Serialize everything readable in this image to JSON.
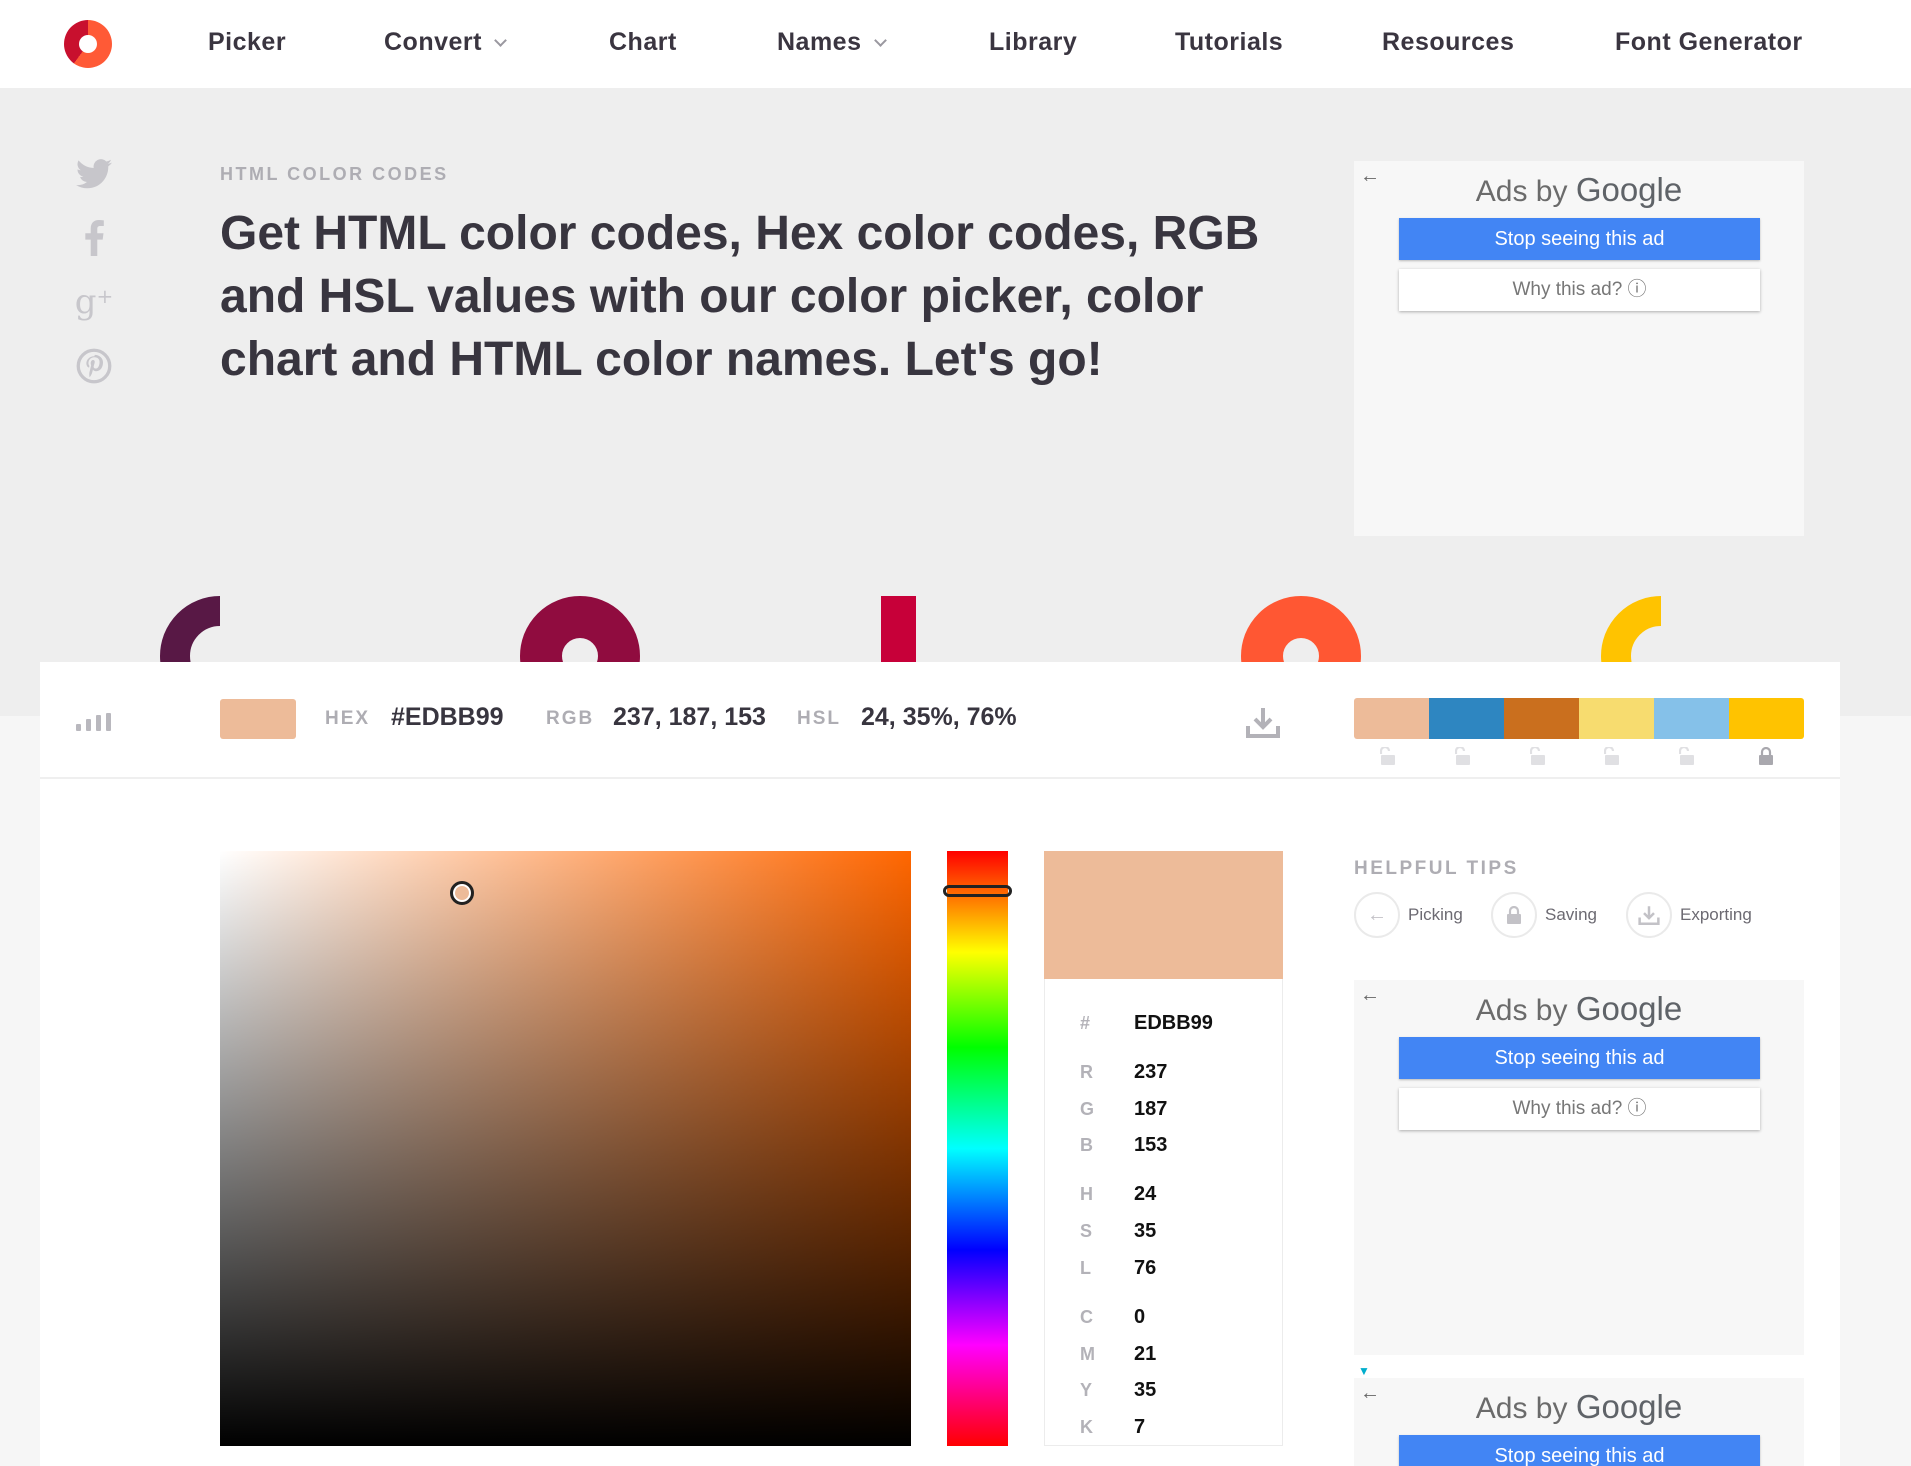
{
  "nav": {
    "items": [
      {
        "label": "Picker",
        "has_dropdown": false
      },
      {
        "label": "Convert",
        "has_dropdown": true
      },
      {
        "label": "Chart",
        "has_dropdown": false
      },
      {
        "label": "Names",
        "has_dropdown": true
      },
      {
        "label": "Library",
        "has_dropdown": false
      },
      {
        "label": "Tutorials",
        "has_dropdown": false
      },
      {
        "label": "Resources",
        "has_dropdown": false
      },
      {
        "label": "Font Generator",
        "has_dropdown": false
      }
    ]
  },
  "social": [
    "twitter-icon",
    "facebook-icon",
    "google-plus-icon",
    "pinterest-icon"
  ],
  "hero": {
    "eyebrow": "HTML COLOR CODES",
    "headline": "Get HTML color codes, Hex color codes, RGB and HSL values with our color picker, color chart and HTML color names. Let's go!"
  },
  "ads": {
    "title_prefix": "Ads by ",
    "title_brand": "Google",
    "stop_label": "Stop seeing this ad",
    "why_label": "Why this ad? ⓘ"
  },
  "colorbar": {
    "hex_label": "HEX",
    "hex_value": "#EDBB99",
    "rgb_label": "RGB",
    "rgb_value": "237, 187, 153",
    "hsl_label": "HSL",
    "hsl_value": "24, 35%, 76%",
    "swatch_color": "#EDBB99"
  },
  "palette": {
    "colors": [
      "#EDBB99",
      "#2E86C1",
      "#CA6F1E",
      "#F7DC6F",
      "#85C1E9",
      "#FFC300"
    ],
    "locked": [
      false,
      false,
      false,
      false,
      false,
      true
    ]
  },
  "decorations": {
    "colors": [
      "#581845",
      "#900C3F",
      "#C70039",
      "#FF5733",
      "#FFC300"
    ]
  },
  "picker": {
    "hue_color": "#ff6600",
    "saturation": 0.35,
    "brightness": 0.93,
    "hue_fraction": 0.067
  },
  "values": {
    "hash_label": "#",
    "hash_value": "EDBB99",
    "groups": [
      [
        {
          "label": "R",
          "value": "237"
        },
        {
          "label": "G",
          "value": "187"
        },
        {
          "label": "B",
          "value": "153"
        }
      ],
      [
        {
          "label": "H",
          "value": "24"
        },
        {
          "label": "S",
          "value": "35"
        },
        {
          "label": "L",
          "value": "76"
        }
      ],
      [
        {
          "label": "C",
          "value": "0"
        },
        {
          "label": "M",
          "value": "21"
        },
        {
          "label": "Y",
          "value": "35"
        },
        {
          "label": "K",
          "value": "7"
        }
      ]
    ]
  },
  "tips": {
    "title": "HELPFUL TIPS",
    "items": [
      {
        "label": "Picking",
        "icon": "arrow-left-icon"
      },
      {
        "label": "Saving",
        "icon": "lock-icon"
      },
      {
        "label": "Exporting",
        "icon": "download-icon"
      }
    ]
  }
}
